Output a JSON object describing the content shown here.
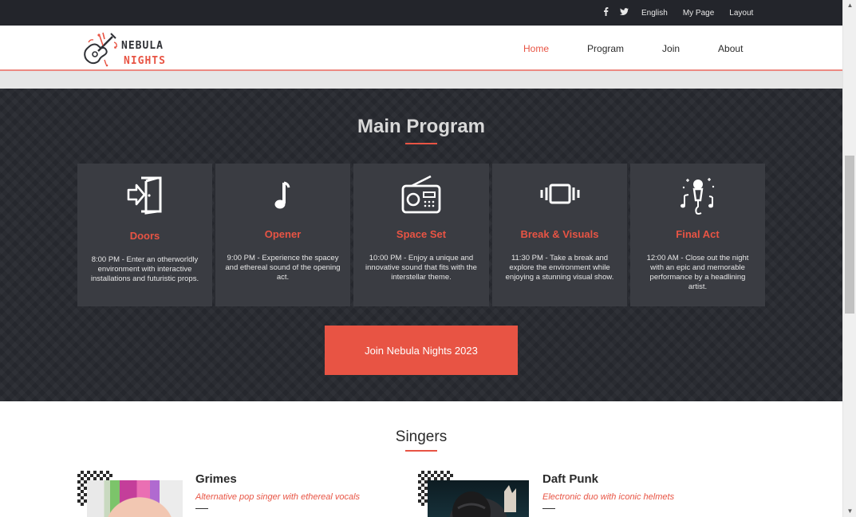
{
  "topbar": {
    "social_icons": [
      "facebook-icon",
      "twitter-icon"
    ],
    "links": [
      "English",
      "My Page",
      "Layout"
    ]
  },
  "brand": {
    "line1": "NEBULA",
    "line2": "NIGHTS",
    "accent": "#e85444"
  },
  "nav": {
    "items": [
      "Home",
      "Program",
      "Join",
      "About"
    ],
    "active": "Home"
  },
  "program": {
    "title": "Main Program",
    "cards": [
      {
        "icon": "door-enter-icon",
        "title": "Doors",
        "desc": "8:00 PM - Enter an otherworldly environment with interactive installations and futuristic props."
      },
      {
        "icon": "music-note-icon",
        "title": "Opener",
        "desc": "9:00 PM - Experience the spacey and ethereal sound of the opening act."
      },
      {
        "icon": "radio-icon",
        "title": "Space Set",
        "desc": "10:00 PM - Enjoy a unique and innovative sound that fits with the interstellar theme."
      },
      {
        "icon": "vibrate-icon",
        "title": "Break & Visuals",
        "desc": "11:30 PM - Take a break and explore the environment while enjoying a stunning visual show."
      },
      {
        "icon": "microphone-icon",
        "title": "Final Act",
        "desc": "12:00 AM - Close out the night with an epic and memorable performance by a headlining artist."
      }
    ],
    "cta": "Join Nebula Nights 2023"
  },
  "singers": {
    "title": "Singers",
    "items": [
      {
        "name": "Grimes",
        "desc": "Alternative pop singer with ethereal vocals"
      },
      {
        "name": "Daft Punk",
        "desc": "Electronic duo with iconic helmets"
      }
    ]
  }
}
